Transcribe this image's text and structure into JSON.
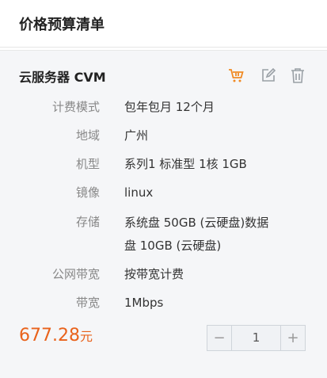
{
  "header": {
    "title": "价格预算清单"
  },
  "product": {
    "title": "云服务器 CVM",
    "icons": [
      "cart-icon",
      "edit-icon",
      "trash-icon"
    ],
    "specs": [
      {
        "label": "计费模式",
        "value": "包年包月 12个月"
      },
      {
        "label": "地域",
        "value": "广州"
      },
      {
        "label": "机型",
        "value": "系列1 标准型 1核 1GB"
      },
      {
        "label": "镜像",
        "value": "linux"
      },
      {
        "label": "存储",
        "value": "系统盘 50GB (云硬盘)数据盘 10GB (云硬盘)"
      },
      {
        "label": "公网带宽",
        "value": "按带宽计费"
      },
      {
        "label": "带宽",
        "value": "1Mbps"
      }
    ],
    "price": {
      "amount": "677.28",
      "unit": "元"
    },
    "quantity": {
      "minus": "−",
      "value": "1",
      "plus": "+"
    }
  },
  "colors": {
    "price": "#e9621b",
    "cart_icon": "#f08a24",
    "card_bg": "#f5f6f8"
  }
}
